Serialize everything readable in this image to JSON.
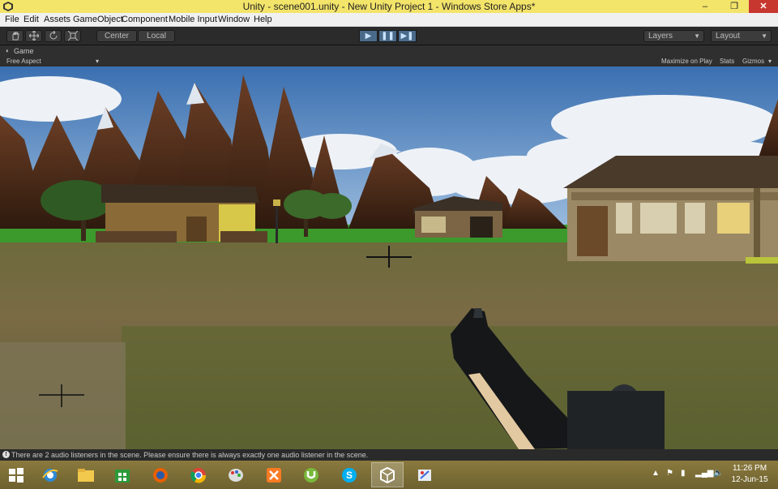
{
  "window": {
    "title": "Unity - scene001.unity - New Unity Project 1 - Windows Store Apps*",
    "minimize": "‒",
    "restore": "❐",
    "close": "✕"
  },
  "menu": {
    "items": [
      "File",
      "Edit",
      "Assets",
      "GameObject",
      "Component",
      "Mobile Input",
      "Window",
      "Help"
    ]
  },
  "toolbar": {
    "pivot_center": "Center",
    "pivot_local": "Local",
    "layers_label": "Layers",
    "layout_label": "Layout"
  },
  "game_view": {
    "tab_label": "Game",
    "aspect": "Free Aspect",
    "maximize_on_play": "Maximize on Play",
    "stats": "Stats",
    "gizmos": "Gizmos"
  },
  "console": {
    "message": "There are 2 audio listeners in the scene. Please ensure there is always exactly one audio listener in the scene."
  },
  "taskbar": {
    "apps": [
      "windows-start-icon",
      "internet-explorer-icon",
      "file-explorer-icon",
      "store-icon",
      "firefox-icon",
      "chrome-icon",
      "paint-icon",
      "xampp-icon",
      "utorrent-icon",
      "skype-icon",
      "unity-icon",
      "paint-net-icon"
    ],
    "time": "11:26 PM",
    "date": "12-Jun-15"
  },
  "colors": {
    "titlebar": "#f3e46a",
    "toolbar": "#2b2b2b",
    "play_active": "#4a6a8a",
    "close_button": "#c7372f",
    "taskbar": "#7d6f3a"
  }
}
